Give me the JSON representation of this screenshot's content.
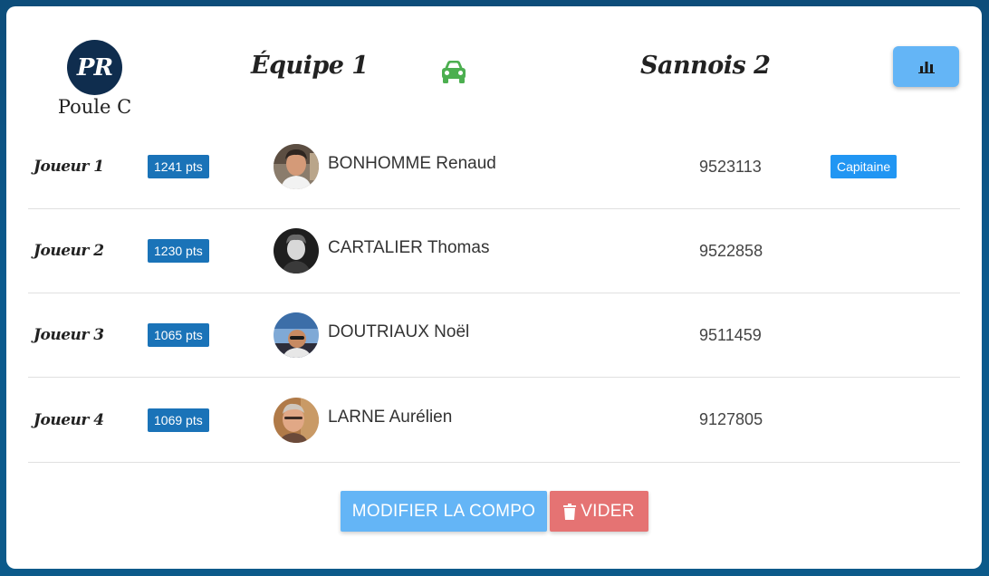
{
  "header": {
    "logo_text": "PR",
    "poule": "Poule C",
    "team_home": "Équipe 1",
    "team_away": "Sannois 2",
    "car_icon": "car-icon",
    "stats_icon": "bar-chart-icon",
    "car_color": "#4caf50"
  },
  "players": [
    {
      "slot": "Joueur 1",
      "pts": "1241 pts",
      "name": "BONHOMME Renaud",
      "licence": "9523113",
      "badge": "Capitaine"
    },
    {
      "slot": "Joueur 2",
      "pts": "1230 pts",
      "name": "CARTALIER Thomas",
      "licence": "9522858",
      "badge": ""
    },
    {
      "slot": "Joueur 3",
      "pts": "1065 pts",
      "name": "DOUTRIAUX Noël",
      "licence": "9511459",
      "badge": ""
    },
    {
      "slot": "Joueur 4",
      "pts": "1069 pts",
      "name": "LARNE Aurélien",
      "licence": "9127805",
      "badge": ""
    }
  ],
  "actions": {
    "modifier_label": "MODIFIER LA COMPO",
    "vider_label": "VIDER",
    "vider_icon": "trash-icon"
  },
  "colors": {
    "pts_badge": "#1a73b8",
    "captain_badge": "#2196f3",
    "modifier_button": "#64b5f6",
    "vider_button": "#e57373",
    "logo_bg": "#0f2d4e"
  }
}
